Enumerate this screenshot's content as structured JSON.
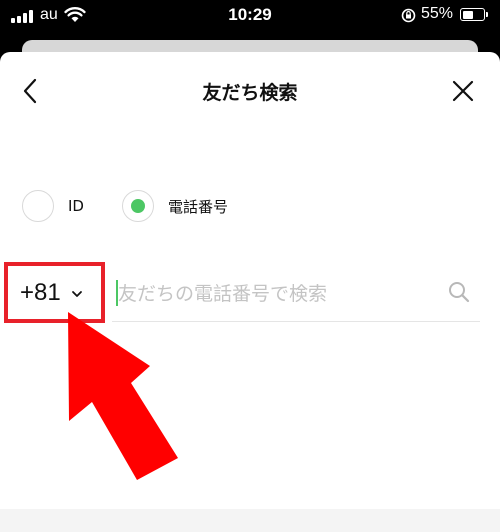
{
  "status_bar": {
    "carrier": "au",
    "time": "10:29",
    "battery_percent": "55%",
    "battery_level": 0.55,
    "signal_icon": "cellular-signal-icon",
    "wifi_icon": "wifi-icon",
    "rotation_lock_icon": "rotation-lock-icon"
  },
  "header": {
    "title": "友だち検索",
    "back_icon": "chevron-left-icon",
    "close_icon": "close-icon"
  },
  "search_type": {
    "options": [
      {
        "label": "ID",
        "selected": false
      },
      {
        "label": "電話番号",
        "selected": true
      }
    ],
    "selected_color": "#4cc764"
  },
  "phone_search": {
    "country_code": "+81",
    "dropdown_icon": "chevron-down-icon",
    "placeholder": "友だちの電話番号で検索",
    "value": "",
    "search_icon": "search-icon",
    "caret_color": "#4cc764"
  },
  "annotation": {
    "highlight_color": "#e8212a",
    "arrow_color": "#ff0000"
  }
}
